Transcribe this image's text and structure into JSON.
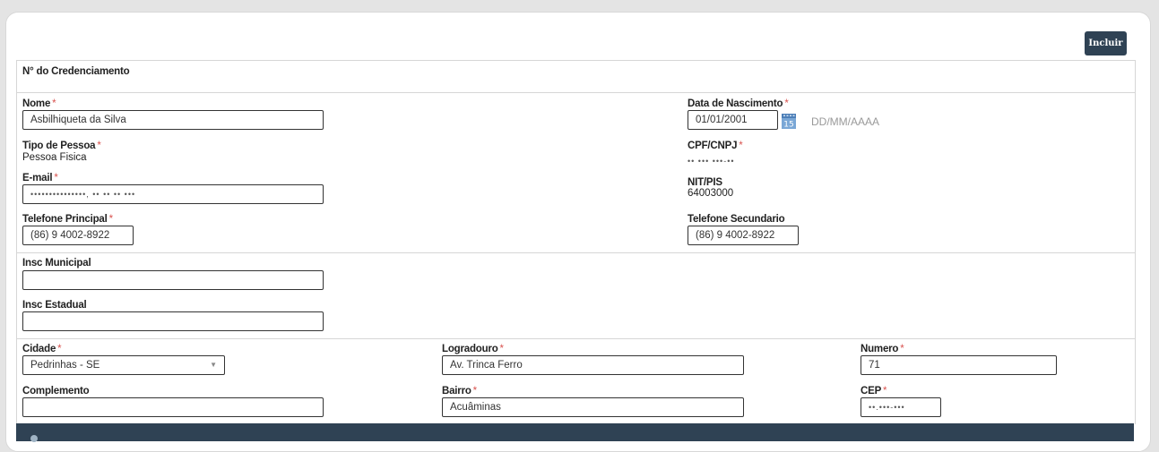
{
  "actions": {
    "include_label": "Incluir"
  },
  "credenciamento": {
    "label": "N° do Credenciamento"
  },
  "person": {
    "nome": {
      "label": "Nome",
      "value": "Asbilhiqueta da Silva"
    },
    "data_nascimento": {
      "label": "Data de Nascimento",
      "value": "01/01/2001",
      "hint": "DD/MM/AAAA"
    },
    "tipo_pessoa": {
      "label": "Tipo de Pessoa",
      "value": "Pessoa Fisica"
    },
    "cpf_cnpj": {
      "label": "CPF/CNPJ",
      "value": "•• ••• •••-••"
    },
    "email": {
      "label": "E-mail",
      "value": "•••••••••••••••,   ••  •• ••  •••"
    },
    "nit_pis": {
      "label": "NIT/PIS",
      "value": "64003000"
    },
    "telefone_principal": {
      "label": "Telefone Principal",
      "value": "(86) 9 4002-8922"
    },
    "telefone_secundario": {
      "label": "Telefone Secundario",
      "value": "(86) 9 4002-8922"
    }
  },
  "inscricoes": {
    "municipal": {
      "label": "Insc Municipal",
      "value": ""
    },
    "estadual": {
      "label": "Insc Estadual",
      "value": ""
    }
  },
  "endereco": {
    "cidade": {
      "label": "Cidade",
      "value": "Pedrinhas - SE"
    },
    "logradouro": {
      "label": "Logradouro",
      "value": "Av. Trinca Ferro"
    },
    "numero": {
      "label": "Numero",
      "value": "71"
    },
    "complemento": {
      "label": "Complemento",
      "value": ""
    },
    "bairro": {
      "label": "Bairro",
      "value": "Acuâminas"
    },
    "cep": {
      "label": "CEP",
      "value": "••.•••-•••"
    }
  },
  "required_mark": "*"
}
